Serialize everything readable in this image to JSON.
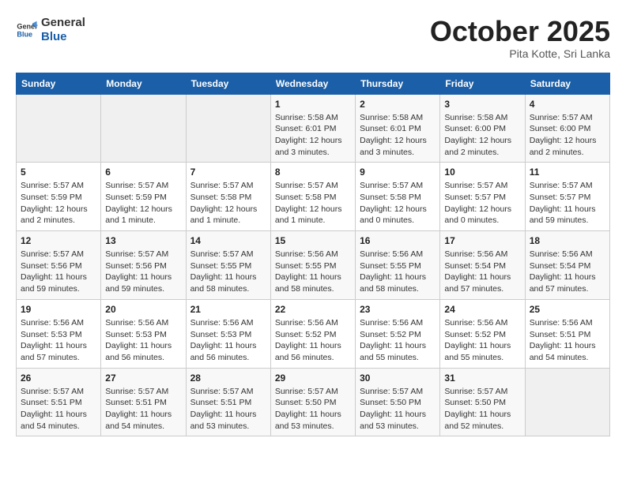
{
  "header": {
    "logo": {
      "general": "General",
      "blue": "Blue"
    },
    "title": "October 2025",
    "subtitle": "Pita Kotte, Sri Lanka"
  },
  "weekdays": [
    "Sunday",
    "Monday",
    "Tuesday",
    "Wednesday",
    "Thursday",
    "Friday",
    "Saturday"
  ],
  "weeks": [
    [
      null,
      null,
      null,
      {
        "day": "1",
        "sunrise": "Sunrise: 5:58 AM",
        "sunset": "Sunset: 6:01 PM",
        "daylight": "Daylight: 12 hours and 3 minutes."
      },
      {
        "day": "2",
        "sunrise": "Sunrise: 5:58 AM",
        "sunset": "Sunset: 6:01 PM",
        "daylight": "Daylight: 12 hours and 3 minutes."
      },
      {
        "day": "3",
        "sunrise": "Sunrise: 5:58 AM",
        "sunset": "Sunset: 6:00 PM",
        "daylight": "Daylight: 12 hours and 2 minutes."
      },
      {
        "day": "4",
        "sunrise": "Sunrise: 5:57 AM",
        "sunset": "Sunset: 6:00 PM",
        "daylight": "Daylight: 12 hours and 2 minutes."
      }
    ],
    [
      {
        "day": "5",
        "sunrise": "Sunrise: 5:57 AM",
        "sunset": "Sunset: 5:59 PM",
        "daylight": "Daylight: 12 hours and 2 minutes."
      },
      {
        "day": "6",
        "sunrise": "Sunrise: 5:57 AM",
        "sunset": "Sunset: 5:59 PM",
        "daylight": "Daylight: 12 hours and 1 minute."
      },
      {
        "day": "7",
        "sunrise": "Sunrise: 5:57 AM",
        "sunset": "Sunset: 5:58 PM",
        "daylight": "Daylight: 12 hours and 1 minute."
      },
      {
        "day": "8",
        "sunrise": "Sunrise: 5:57 AM",
        "sunset": "Sunset: 5:58 PM",
        "daylight": "Daylight: 12 hours and 1 minute."
      },
      {
        "day": "9",
        "sunrise": "Sunrise: 5:57 AM",
        "sunset": "Sunset: 5:58 PM",
        "daylight": "Daylight: 12 hours and 0 minutes."
      },
      {
        "day": "10",
        "sunrise": "Sunrise: 5:57 AM",
        "sunset": "Sunset: 5:57 PM",
        "daylight": "Daylight: 12 hours and 0 minutes."
      },
      {
        "day": "11",
        "sunrise": "Sunrise: 5:57 AM",
        "sunset": "Sunset: 5:57 PM",
        "daylight": "Daylight: 11 hours and 59 minutes."
      }
    ],
    [
      {
        "day": "12",
        "sunrise": "Sunrise: 5:57 AM",
        "sunset": "Sunset: 5:56 PM",
        "daylight": "Daylight: 11 hours and 59 minutes."
      },
      {
        "day": "13",
        "sunrise": "Sunrise: 5:57 AM",
        "sunset": "Sunset: 5:56 PM",
        "daylight": "Daylight: 11 hours and 59 minutes."
      },
      {
        "day": "14",
        "sunrise": "Sunrise: 5:57 AM",
        "sunset": "Sunset: 5:55 PM",
        "daylight": "Daylight: 11 hours and 58 minutes."
      },
      {
        "day": "15",
        "sunrise": "Sunrise: 5:56 AM",
        "sunset": "Sunset: 5:55 PM",
        "daylight": "Daylight: 11 hours and 58 minutes."
      },
      {
        "day": "16",
        "sunrise": "Sunrise: 5:56 AM",
        "sunset": "Sunset: 5:55 PM",
        "daylight": "Daylight: 11 hours and 58 minutes."
      },
      {
        "day": "17",
        "sunrise": "Sunrise: 5:56 AM",
        "sunset": "Sunset: 5:54 PM",
        "daylight": "Daylight: 11 hours and 57 minutes."
      },
      {
        "day": "18",
        "sunrise": "Sunrise: 5:56 AM",
        "sunset": "Sunset: 5:54 PM",
        "daylight": "Daylight: 11 hours and 57 minutes."
      }
    ],
    [
      {
        "day": "19",
        "sunrise": "Sunrise: 5:56 AM",
        "sunset": "Sunset: 5:53 PM",
        "daylight": "Daylight: 11 hours and 57 minutes."
      },
      {
        "day": "20",
        "sunrise": "Sunrise: 5:56 AM",
        "sunset": "Sunset: 5:53 PM",
        "daylight": "Daylight: 11 hours and 56 minutes."
      },
      {
        "day": "21",
        "sunrise": "Sunrise: 5:56 AM",
        "sunset": "Sunset: 5:53 PM",
        "daylight": "Daylight: 11 hours and 56 minutes."
      },
      {
        "day": "22",
        "sunrise": "Sunrise: 5:56 AM",
        "sunset": "Sunset: 5:52 PM",
        "daylight": "Daylight: 11 hours and 56 minutes."
      },
      {
        "day": "23",
        "sunrise": "Sunrise: 5:56 AM",
        "sunset": "Sunset: 5:52 PM",
        "daylight": "Daylight: 11 hours and 55 minutes."
      },
      {
        "day": "24",
        "sunrise": "Sunrise: 5:56 AM",
        "sunset": "Sunset: 5:52 PM",
        "daylight": "Daylight: 11 hours and 55 minutes."
      },
      {
        "day": "25",
        "sunrise": "Sunrise: 5:56 AM",
        "sunset": "Sunset: 5:51 PM",
        "daylight": "Daylight: 11 hours and 54 minutes."
      }
    ],
    [
      {
        "day": "26",
        "sunrise": "Sunrise: 5:57 AM",
        "sunset": "Sunset: 5:51 PM",
        "daylight": "Daylight: 11 hours and 54 minutes."
      },
      {
        "day": "27",
        "sunrise": "Sunrise: 5:57 AM",
        "sunset": "Sunset: 5:51 PM",
        "daylight": "Daylight: 11 hours and 54 minutes."
      },
      {
        "day": "28",
        "sunrise": "Sunrise: 5:57 AM",
        "sunset": "Sunset: 5:51 PM",
        "daylight": "Daylight: 11 hours and 53 minutes."
      },
      {
        "day": "29",
        "sunrise": "Sunrise: 5:57 AM",
        "sunset": "Sunset: 5:50 PM",
        "daylight": "Daylight: 11 hours and 53 minutes."
      },
      {
        "day": "30",
        "sunrise": "Sunrise: 5:57 AM",
        "sunset": "Sunset: 5:50 PM",
        "daylight": "Daylight: 11 hours and 53 minutes."
      },
      {
        "day": "31",
        "sunrise": "Sunrise: 5:57 AM",
        "sunset": "Sunset: 5:50 PM",
        "daylight": "Daylight: 11 hours and 52 minutes."
      },
      null
    ]
  ]
}
